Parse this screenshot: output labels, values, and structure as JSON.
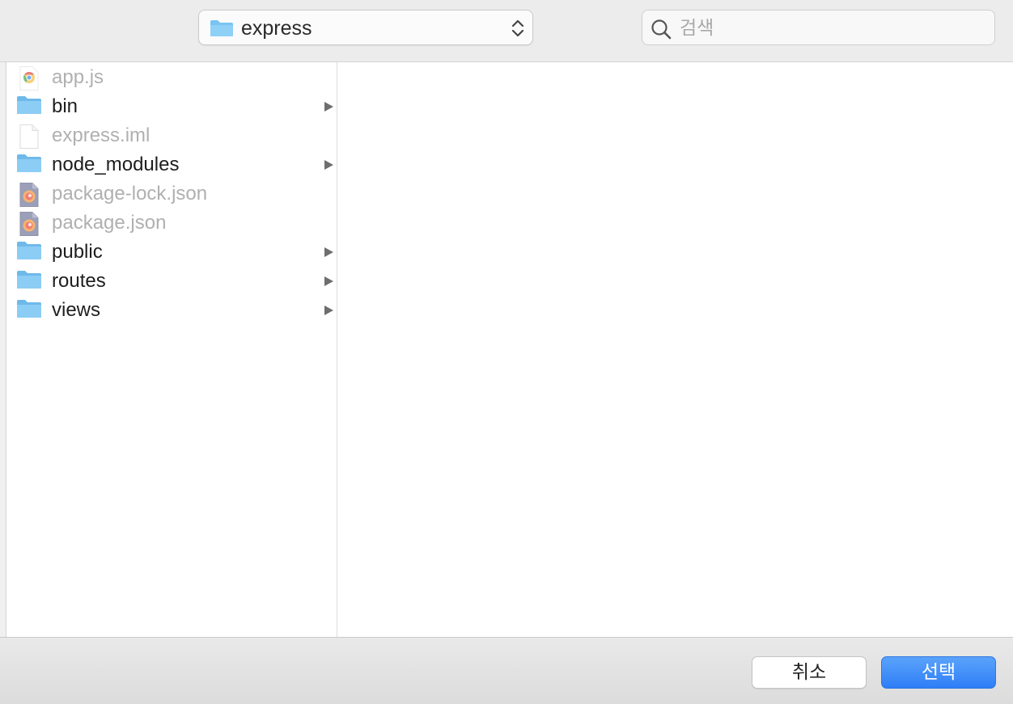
{
  "toolbar": {
    "path_label": "express",
    "search_placeholder": "검색"
  },
  "files": [
    {
      "name": "app.js",
      "kind": "file",
      "icon": "chrome-js-file-icon",
      "enabled": false,
      "has_children": false
    },
    {
      "name": "bin",
      "kind": "folder",
      "icon": "folder-icon",
      "enabled": true,
      "has_children": true
    },
    {
      "name": "express.iml",
      "kind": "file",
      "icon": "blank-document-icon",
      "enabled": false,
      "has_children": false
    },
    {
      "name": "node_modules",
      "kind": "folder",
      "icon": "folder-icon",
      "enabled": true,
      "has_children": true
    },
    {
      "name": "package-lock.json",
      "kind": "file",
      "icon": "firefox-document-icon",
      "enabled": false,
      "has_children": false
    },
    {
      "name": "package.json",
      "kind": "file",
      "icon": "firefox-document-icon",
      "enabled": false,
      "has_children": false
    },
    {
      "name": "public",
      "kind": "folder",
      "icon": "folder-icon",
      "enabled": true,
      "has_children": true
    },
    {
      "name": "routes",
      "kind": "folder",
      "icon": "folder-icon",
      "enabled": true,
      "has_children": true
    },
    {
      "name": "views",
      "kind": "folder",
      "icon": "folder-icon",
      "enabled": true,
      "has_children": true
    }
  ],
  "buttons": {
    "cancel": "취소",
    "choose": "선택"
  },
  "colors": {
    "accent": "#2f7ef6",
    "folder": "#79c4f2",
    "disabled_text": "#b0b0b0"
  }
}
